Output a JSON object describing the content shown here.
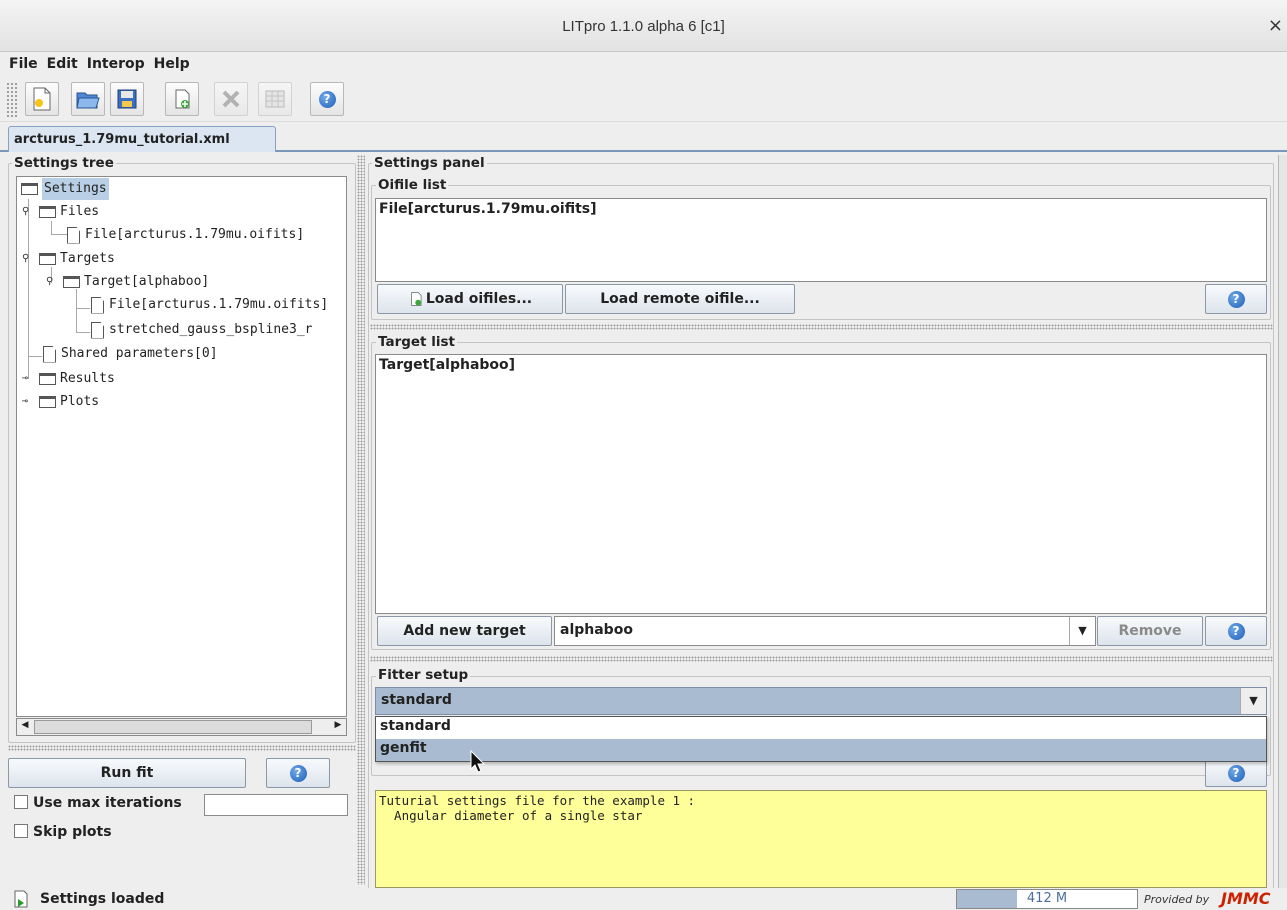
{
  "window": {
    "title": "LITpro 1.1.0 alpha 6 [c1]",
    "close_glyph": "×"
  },
  "menu": [
    "File",
    "Edit",
    "Interop",
    "Help"
  ],
  "toolbar": {
    "buttons": [
      {
        "name": "new-file-icon",
        "enabled": true
      },
      {
        "name": "open-folder-icon",
        "enabled": true
      },
      {
        "name": "save-icon",
        "enabled": true
      },
      {
        "name": "add-oifile-icon",
        "enabled": true
      },
      {
        "name": "delete-icon",
        "enabled": false
      },
      {
        "name": "table-icon",
        "enabled": false
      },
      {
        "name": "help-icon",
        "enabled": true
      }
    ]
  },
  "tab": {
    "label": "arcturus_1.79mu_tutorial.xml"
  },
  "left": {
    "tree_title": "Settings tree",
    "tree": {
      "settings": "Settings",
      "files": "Files",
      "file1": "File[arcturus.1.79mu.oifits]",
      "targets": "Targets",
      "target": "Target[alphaboo]",
      "target_file": "File[arcturus.1.79mu.oifits]",
      "target_model": "stretched_gauss_bspline3_r",
      "shared": "Shared parameters[0]",
      "results": "Results",
      "plots": "Plots"
    },
    "run_fit": "Run fit",
    "use_max_iterations": "Use max iterations",
    "max_iterations_value": "",
    "skip_plots": "Skip plots"
  },
  "settings_panel": {
    "title": "Settings panel",
    "oifile_list": {
      "title": "Oifile list",
      "items": [
        "File[arcturus.1.79mu.oifits]"
      ],
      "load_oifiles": "Load oifiles...",
      "load_remote": "Load remote oifile..."
    },
    "target_list": {
      "title": "Target list",
      "items": [
        "Target[alphaboo]"
      ],
      "add_new_target": "Add new target",
      "selected_target": "alphaboo",
      "remove": "Remove"
    },
    "fitter_setup": {
      "title": "Fitter setup",
      "selected": "standard",
      "options": [
        "standard",
        "genfit"
      ],
      "highlighted": "genfit"
    },
    "description": "Tuturial settings file for the example 1 :\n  Angular diameter of a single star"
  },
  "status": {
    "message": "Settings loaded",
    "memory": "412 M",
    "provided_by": "Provided by",
    "brand": "JMMC"
  },
  "colors": {
    "selection": "#b8cfe5",
    "combo_bg": "#a9bbd1",
    "description_bg": "#ffff99",
    "brand": "#cc2200"
  }
}
